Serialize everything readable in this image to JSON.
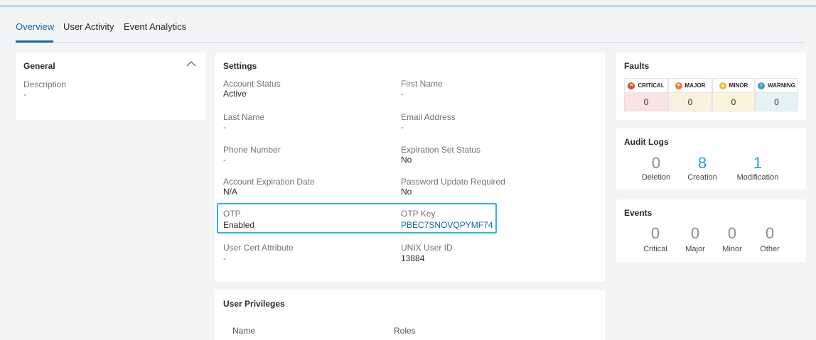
{
  "tabs": [
    {
      "label": "Overview"
    },
    {
      "label": "User Activity"
    },
    {
      "label": "Event Analytics"
    }
  ],
  "general": {
    "title": "General",
    "description_label": "Description",
    "description_value": "-"
  },
  "settings": {
    "title": "Settings",
    "account_status_label": "Account Status",
    "account_status_value": "Active",
    "first_name_label": "First Name",
    "first_name_value": "-",
    "last_name_label": "Last Name",
    "last_name_value": "-",
    "email_label": "Email Address",
    "email_value": "-",
    "phone_label": "Phone Number",
    "phone_value": "-",
    "expiration_set_label": "Expiration Set Status",
    "expiration_set_value": "No",
    "account_expiration_label": "Account Expiration Date",
    "account_expiration_value": "N/A",
    "password_update_label": "Password Update Required",
    "password_update_value": "No",
    "otp_label": "OTP",
    "otp_value": "Enabled",
    "otp_key_label": "OTP Key",
    "otp_key_value": "PBEC7SNOVQPYMF74",
    "user_cert_label": "User Cert Attribute",
    "user_cert_value": "-",
    "unix_uid_label": "UNIX User ID",
    "unix_uid_value": "13884"
  },
  "privileges": {
    "title": "User Privileges",
    "col_name": "Name",
    "col_roles": "Roles"
  },
  "faults": {
    "title": "Faults",
    "items": [
      {
        "label": "CRITICAL",
        "value": "0",
        "color": "#e2412f",
        "bg": "#fbe3e2",
        "glyph": "✕"
      },
      {
        "label": "MAJOR",
        "value": "0",
        "color": "#f07a3c",
        "bg": "#fdf0de",
        "glyph": "▼"
      },
      {
        "label": "MINOR",
        "value": "0",
        "color": "#f5bd2b",
        "bg": "#fdf5db",
        "glyph": "▲"
      },
      {
        "label": "WARNING",
        "value": "0",
        "color": "#3d9dbf",
        "bg": "#e4f3f1",
        "glyph": "i"
      }
    ]
  },
  "audit_logs": {
    "title": "Audit Logs",
    "items": [
      {
        "value": "0",
        "label": "Deletion"
      },
      {
        "value": "8",
        "label": "Creation"
      },
      {
        "value": "1",
        "label": "Modification"
      }
    ]
  },
  "events": {
    "title": "Events",
    "items": [
      {
        "value": "0",
        "label": "Critical"
      },
      {
        "value": "0",
        "label": "Major"
      },
      {
        "value": "0",
        "label": "Minor"
      },
      {
        "value": "0",
        "label": "Other"
      }
    ]
  }
}
